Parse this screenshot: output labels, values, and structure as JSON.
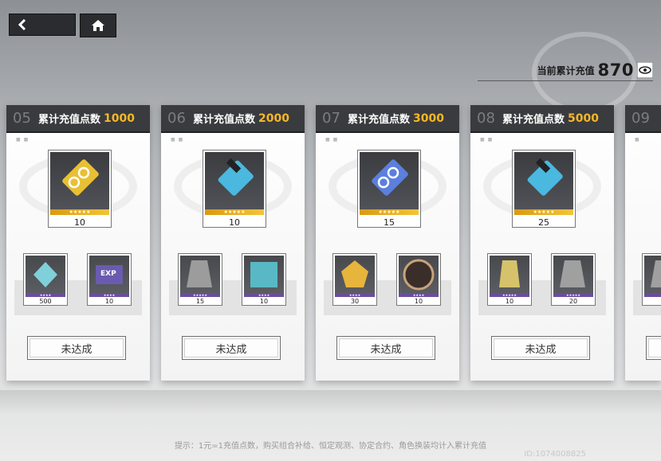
{
  "nav": {
    "back_icon": "back-arrow-icon",
    "home_icon": "home-icon"
  },
  "total": {
    "label": "当前累计充值",
    "value": "870",
    "icon": "eye-icon"
  },
  "cards": [
    {
      "num": "05",
      "label": "累计充值点数",
      "target": "1000",
      "main": {
        "qty": "10",
        "stars": "★★★★★",
        "color": "#e9c033"
      },
      "subs": [
        {
          "qty": "500",
          "stars": "★★★★",
          "color": "#7fd0d9"
        },
        {
          "qty": "10",
          "stars": "★★★★",
          "color": "#6a5bb0",
          "tag": "EXP"
        }
      ],
      "status": "未达成"
    },
    {
      "num": "06",
      "label": "累计充值点数",
      "target": "2000",
      "main": {
        "qty": "10",
        "stars": "★★★★★",
        "color": "#4ab8df"
      },
      "subs": [
        {
          "qty": "15",
          "stars": "★★★★★",
          "color": "#9c9c9c"
        },
        {
          "qty": "10",
          "stars": "★★★★",
          "color": "#58b9c4"
        }
      ],
      "status": "未达成"
    },
    {
      "num": "07",
      "label": "累计充值点数",
      "target": "3000",
      "main": {
        "qty": "15",
        "stars": "★★★★★",
        "color": "#5b7fdc"
      },
      "subs": [
        {
          "qty": "30",
          "stars": "★★★★",
          "color": "#e7b43c"
        },
        {
          "qty": "10",
          "stars": "★★★★",
          "color": "#c9a27a"
        }
      ],
      "status": "未达成"
    },
    {
      "num": "08",
      "label": "累计充值点数",
      "target": "5000",
      "main": {
        "qty": "25",
        "stars": "★★★★★",
        "color": "#4ab8df"
      },
      "subs": [
        {
          "qty": "10",
          "stars": "★★★★★",
          "color": "#d6c26a"
        },
        {
          "qty": "20",
          "stars": "★★★★★",
          "color": "#a0a0a0"
        }
      ],
      "status": "未达成"
    },
    {
      "num": "09",
      "label": "",
      "target": "",
      "main": {
        "qty": "",
        "stars": "",
        "color": "#4ab8df"
      },
      "subs": [
        {
          "qty": "",
          "stars": "",
          "color": "#a0a0a0"
        }
      ],
      "status": ""
    }
  ],
  "tip": "提示：1元=1充值点数，购买组合补给、恒定观测、协定合约、角色换装均计入累计充值",
  "uid": "ID:1074008825"
}
